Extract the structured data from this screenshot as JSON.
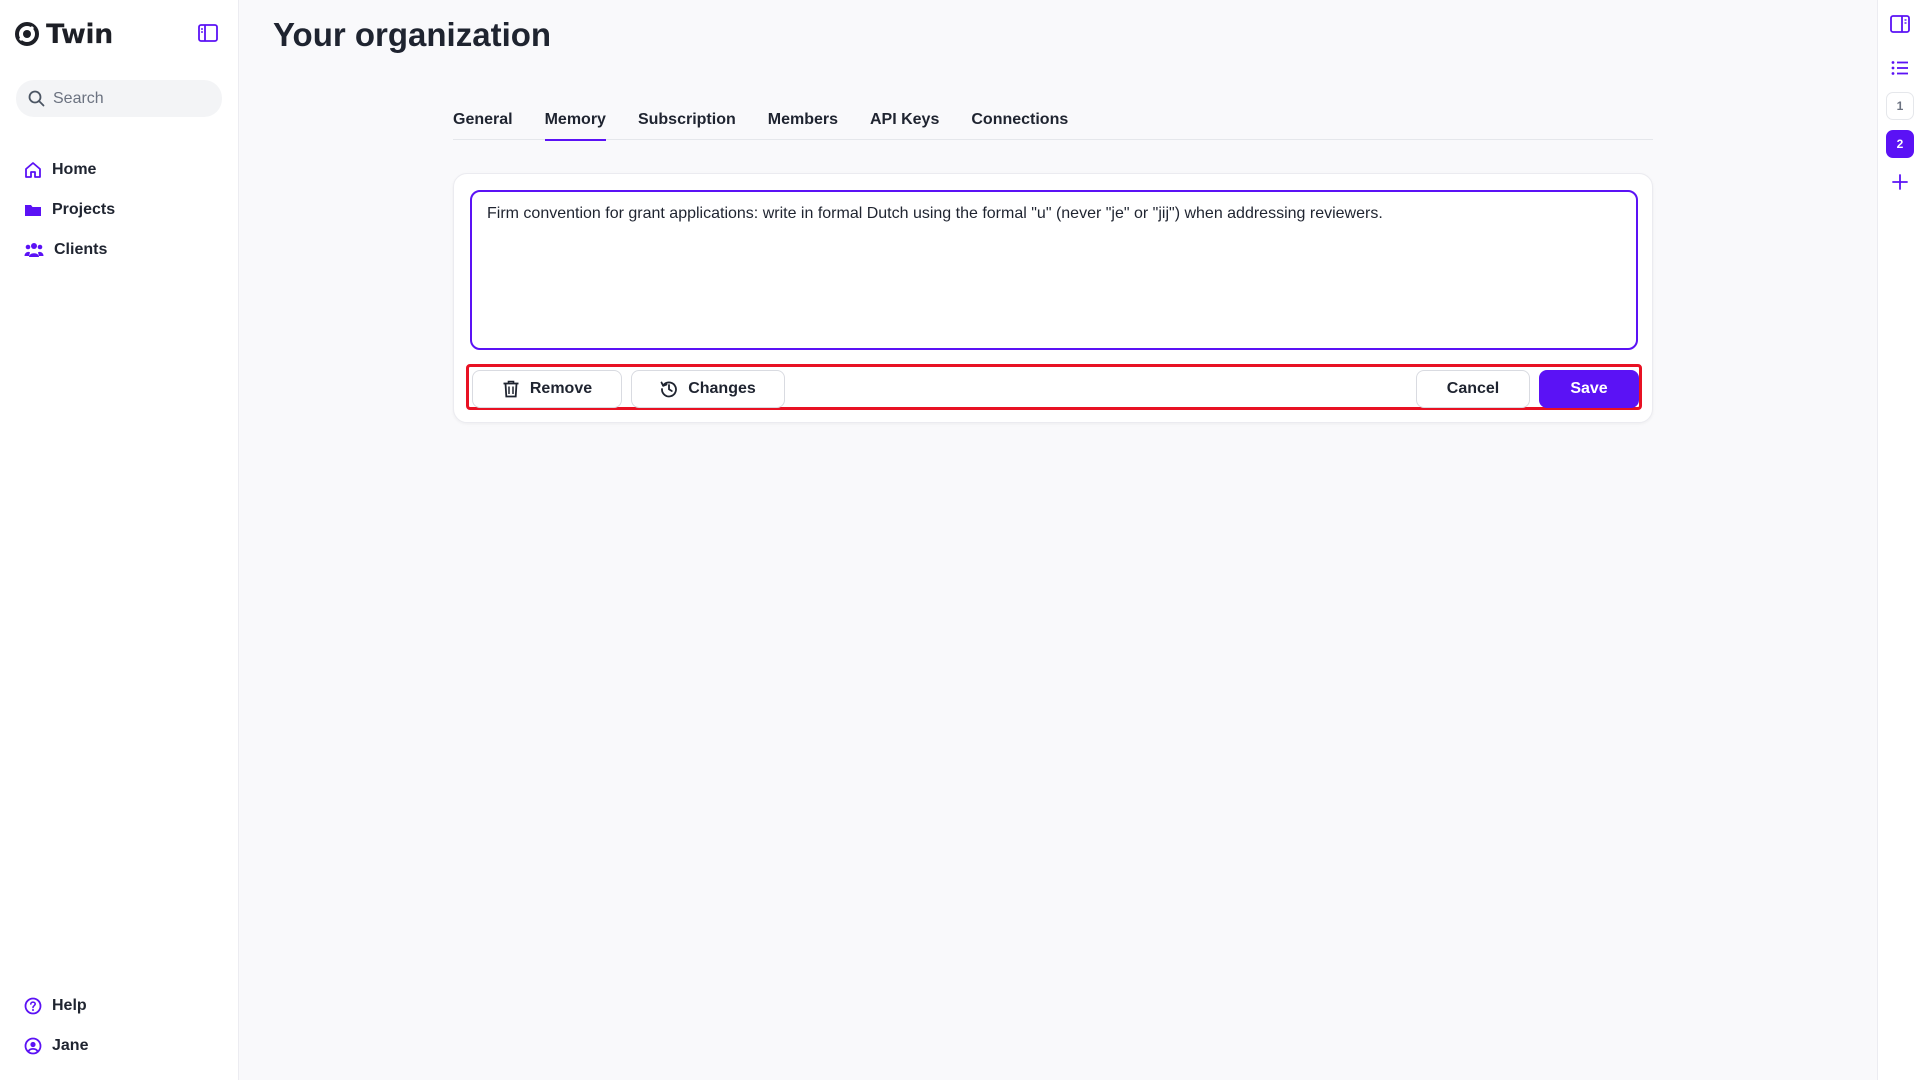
{
  "app": {
    "name": "Twin"
  },
  "sidebar": {
    "search": {
      "placeholder": "Search",
      "value": ""
    },
    "nav": [
      {
        "label": "Home",
        "icon": "home-icon"
      },
      {
        "label": "Projects",
        "icon": "folder-icon"
      },
      {
        "label": "Clients",
        "icon": "users-icon"
      }
    ],
    "bottom": [
      {
        "label": "Help",
        "icon": "help-icon"
      },
      {
        "label": "Jane",
        "icon": "user-circle-icon"
      }
    ]
  },
  "main": {
    "title": "Your organization",
    "tabs": [
      {
        "label": "General",
        "active": false
      },
      {
        "label": "Memory",
        "active": true
      },
      {
        "label": "Subscription",
        "active": false
      },
      {
        "label": "Members",
        "active": false
      },
      {
        "label": "API Keys",
        "active": false
      },
      {
        "label": "Connections",
        "active": false
      }
    ],
    "memory": {
      "text": "Firm convention for grant applications: write in formal Dutch using the formal \"u\" (never \"je\" or \"jij\") when addressing reviewers.",
      "remove_label": "Remove",
      "changes_label": "Changes",
      "cancel_label": "Cancel",
      "save_label": "Save"
    }
  },
  "rail": {
    "pages": [
      "1",
      "2"
    ],
    "active_page": "2"
  },
  "colors": {
    "accent": "#5b12f5",
    "highlight": "#e81123"
  }
}
